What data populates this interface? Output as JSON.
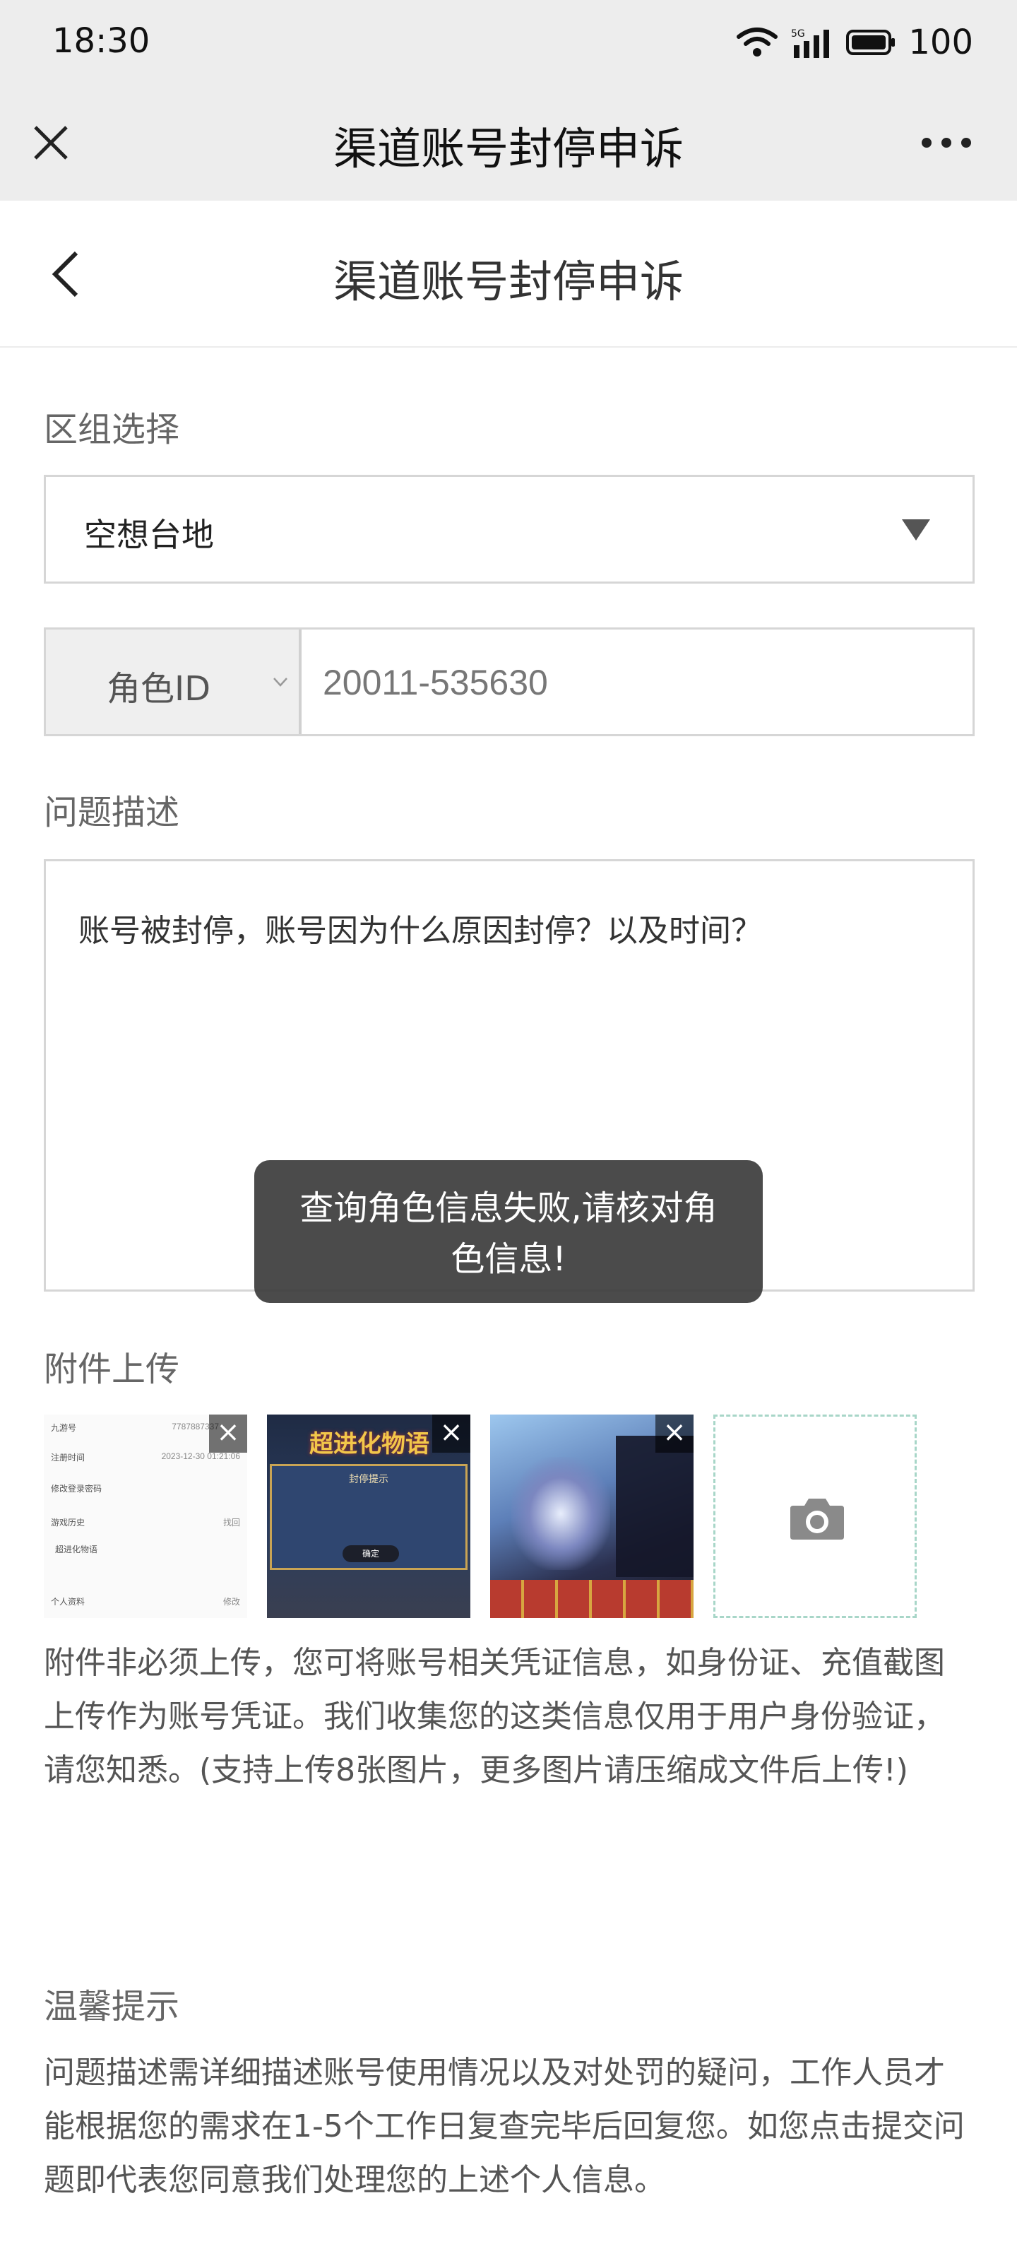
{
  "status_bar": {
    "time": "18:30",
    "signal_label": "5G",
    "battery": "100"
  },
  "title_bar": {
    "title": "渠道账号封停申诉"
  },
  "page_header": {
    "title": "渠道账号封停申诉"
  },
  "form": {
    "region_label": "区组选择",
    "region_value": "空想台地",
    "role_type": "角色ID",
    "role_value": "20011-535630",
    "desc_label": "问题描述",
    "desc_value": "账号被封停，账号因为什么原因封停？以及时间？",
    "attach_label": "附件上传"
  },
  "toast": {
    "line1": "查询角色信息失败,请核对角",
    "line2": "色信息!"
  },
  "thumbs": {
    "t1": {
      "rows": [
        {
          "k": "九游号",
          "v": "7787887337"
        },
        {
          "k": "注册时间",
          "v": "2023-12-30 01:21:06"
        },
        {
          "k": "修改登录密码",
          "v": ""
        },
        {
          "k": "游戏历史",
          "v": "找回"
        },
        {
          "k": "超进化物语",
          "v": ""
        },
        {
          "k": "个人资料",
          "v": "修改"
        }
      ]
    },
    "t2": {
      "logo": "超进化物语",
      "dialog_title": "封停提示",
      "ok": "确定"
    }
  },
  "attach_note": "附件非必须上传，您可将账号相关凭证信息，如身份证、充值截图上传作为账号凭证。我们收集您的这类信息仅用于用户身份验证，请您知悉。(支持上传8张图片，更多图片请压缩成文件后上传!)",
  "tips": {
    "title": "温馨提示",
    "body": "问题描述需详细描述账号使用情况以及对处罚的疑问，工作人员才能根据您的需求在1-5个工作日复查完毕后回复您。如您点击提交问题即代表您同意我们处理您的上述个人信息。"
  },
  "colors": {
    "bar_bg": "#ededed",
    "toast_bg": "#3c3c3c",
    "upload_border": "#a8d6c8"
  }
}
